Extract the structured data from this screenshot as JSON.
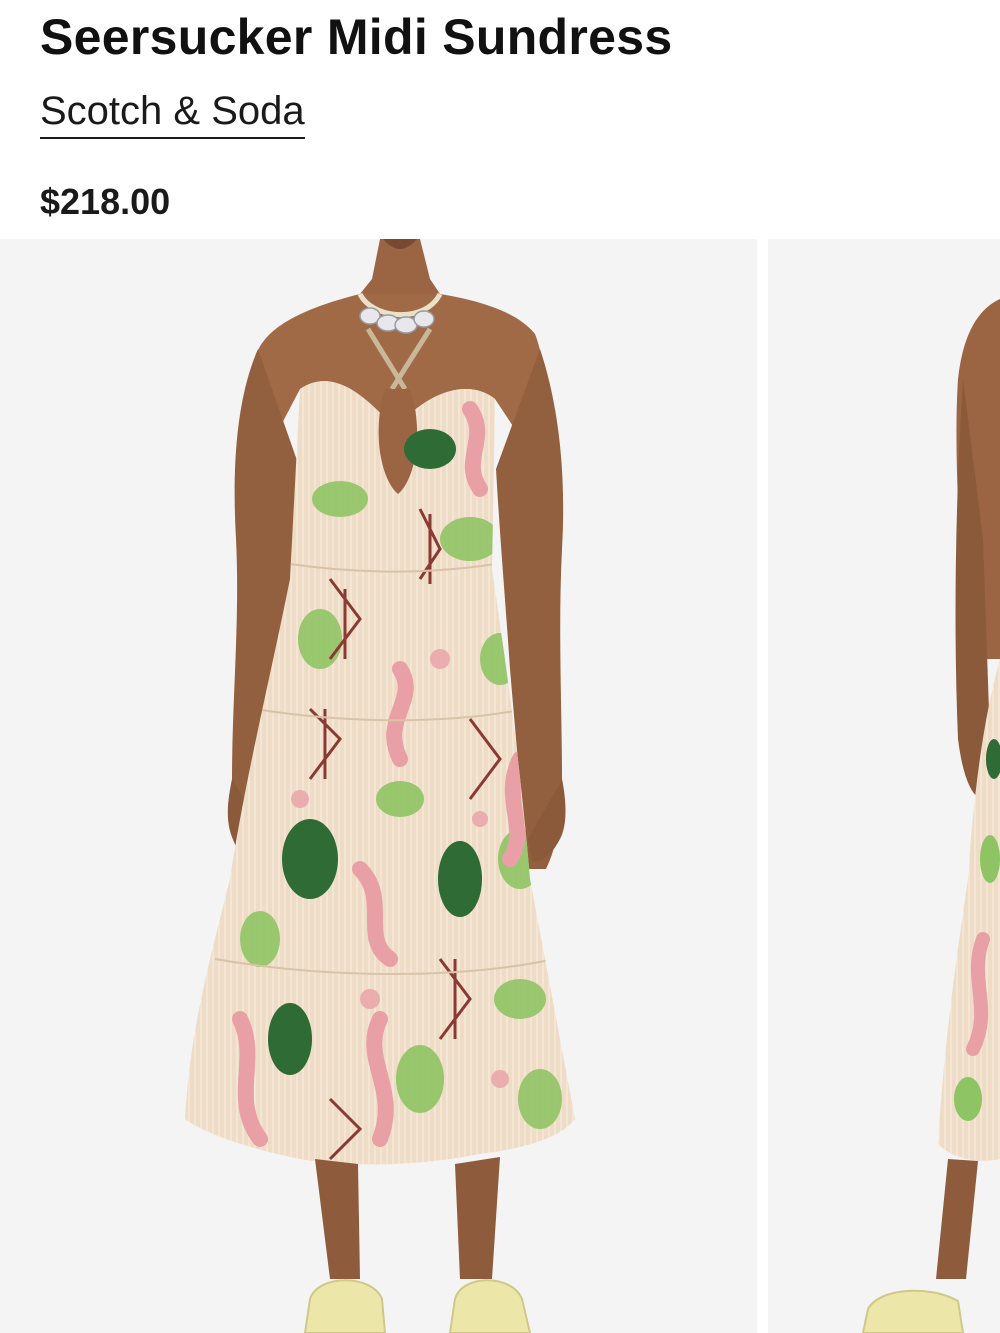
{
  "product": {
    "title": "Seersucker Midi Sundress",
    "brand": "Scotch & Soda",
    "price": "$218.00"
  },
  "gallery": {
    "images": [
      {
        "alt": "Seersucker Midi Sundress front view"
      },
      {
        "alt": "Seersucker Midi Sundress side view"
      }
    ]
  },
  "colors": {
    "text": "#111111",
    "photo_background": "#f4f4f4",
    "dress_base": "#efdcc7",
    "print_green": "#8fc464",
    "print_dark_green": "#2f6b35",
    "print_pink": "#e8a0a6",
    "print_maroon": "#8a3a32",
    "skin": "#9b6543",
    "sandal": "#ece7a9"
  }
}
